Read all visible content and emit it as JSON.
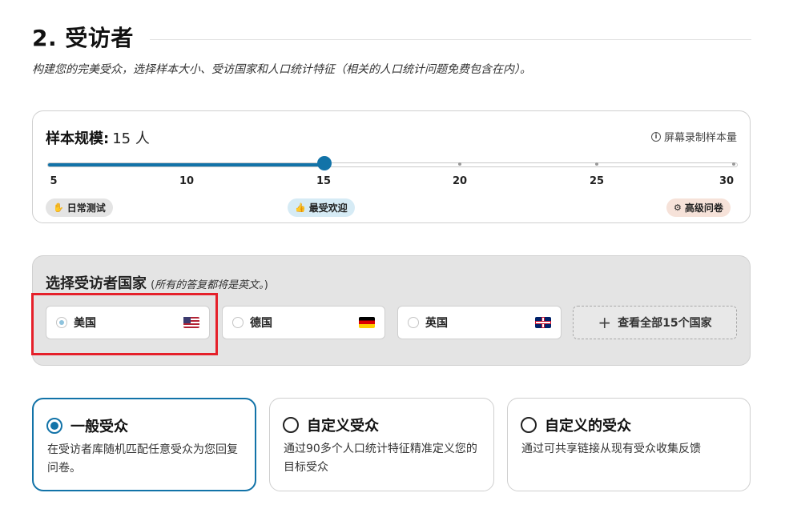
{
  "section": {
    "title": "2. 受访者",
    "subtitle": "构建您的完美受众，选择样本大小、受访国家和人口统计特征（相关的人口统计问题免费包含在内）。"
  },
  "sample": {
    "label": "样本规模:",
    "value_text": "15 人",
    "value": 15,
    "min": 5,
    "max": 30,
    "record_link": "屏幕录制样本量",
    "info_icon": "info-icon",
    "ticks": [
      "5",
      "10",
      "15",
      "20",
      "25",
      "30"
    ],
    "tags": {
      "daily": {
        "icon": "hand-icon",
        "label": "日常测试"
      },
      "popular": {
        "icon": "thumbs-up-icon",
        "label": "最受欢迎"
      },
      "advanced": {
        "icon": "gears-icon",
        "label": "高级问卷"
      }
    }
  },
  "countries": {
    "heading": "选择受访者国家",
    "note_open": "(",
    "note": "所有的答复都将是英文。",
    "note_close": ")",
    "items": [
      {
        "name": "美国",
        "flag": "us-flag",
        "selected": true
      },
      {
        "name": "德国",
        "flag": "de-flag",
        "selected": false
      },
      {
        "name": "英国",
        "flag": "uk-flag",
        "selected": false
      }
    ],
    "view_all": "查看全部15个国家",
    "highlight_color": "#e5202a"
  },
  "audiences": [
    {
      "label": "一般受众",
      "desc": "在受访者库随机匹配任意受众为您回复问卷。",
      "selected": true
    },
    {
      "label": "自定义受众",
      "desc": "通过90多个人口统计特征精准定义您的目标受众",
      "selected": false
    },
    {
      "label": "自定义的受众",
      "desc": "通过可共享链接从现有受众收集反馈",
      "selected": false
    }
  ],
  "colors": {
    "accent": "#1273a8",
    "highlight": "#e5202a"
  }
}
